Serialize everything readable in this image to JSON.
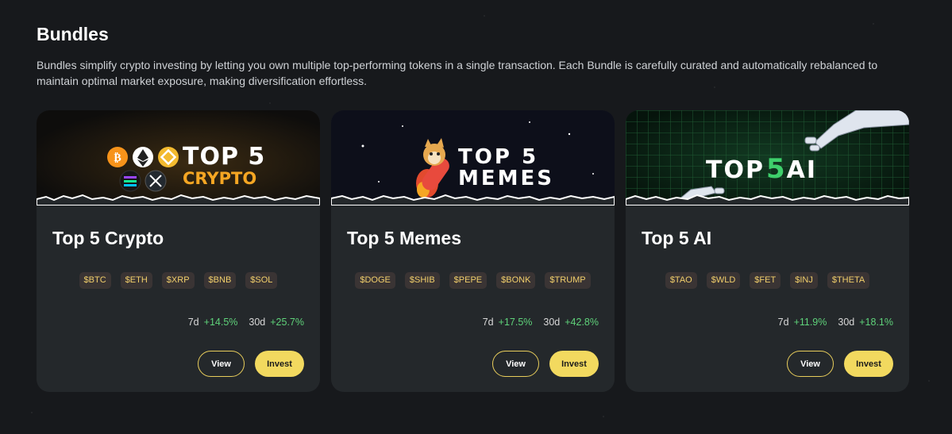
{
  "section": {
    "title": "Bundles",
    "description": "Bundles simplify crypto investing by letting you own multiple top-performing tokens in a single transaction. Each Bundle is carefully curated and automatically rebalanced to maintain optimal market exposure, making diversification effortless."
  },
  "bundles": [
    {
      "banner": {
        "line1": "TOP 5",
        "line2": "CRYPTO",
        "accent": "#f5a623"
      },
      "title": "Top 5 Crypto",
      "tokens": [
        "$BTC",
        "$ETH",
        "$XRP",
        "$BNB",
        "$SOL"
      ],
      "stat_7d_label": "7d",
      "stat_7d_value": "+14.5%",
      "stat_30d_label": "30d",
      "stat_30d_value": "+25.7%",
      "view_label": "View",
      "invest_label": "Invest"
    },
    {
      "banner": {
        "line1": "TOP 5",
        "line2": "MEMES",
        "accent": "#e8453c"
      },
      "title": "Top 5 Memes",
      "tokens": [
        "$DOGE",
        "$SHIB",
        "$PEPE",
        "$BONK",
        "$TRUMP"
      ],
      "stat_7d_label": "7d",
      "stat_7d_value": "+17.5%",
      "stat_30d_label": "30d",
      "stat_30d_value": "+42.8%",
      "view_label": "View",
      "invest_label": "Invest"
    },
    {
      "banner": {
        "line1": "TOP",
        "num": "5",
        "line2": "AI",
        "accent": "#3ecf6b"
      },
      "title": "Top 5 AI",
      "tokens": [
        "$TAO",
        "$WLD",
        "$FET",
        "$INJ",
        "$THETA"
      ],
      "stat_7d_label": "7d",
      "stat_7d_value": "+11.9%",
      "stat_30d_label": "30d",
      "stat_30d_value": "+18.1%",
      "view_label": "View",
      "invest_label": "Invest"
    }
  ],
  "colors": {
    "background": "#17191c",
    "card": "#24282b",
    "tag_text": "#f2cf6b",
    "positive": "#5fd27a",
    "invest_button": "#f2d95f"
  }
}
